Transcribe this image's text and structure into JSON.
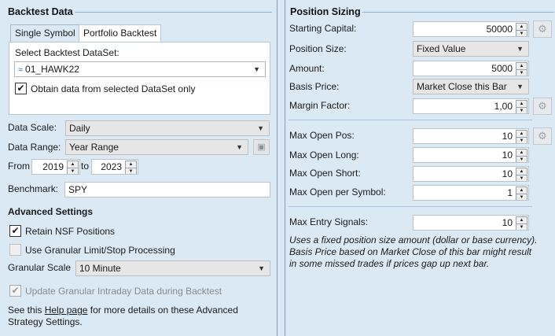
{
  "backtest": {
    "title": "Backtest Data",
    "tabs": [
      {
        "label": "Single Symbol",
        "active": false
      },
      {
        "label": "Portfolio Backtest",
        "active": true
      }
    ],
    "select_dataset_label": "Select Backtest DataSet:",
    "dataset_value": "01_HAWK22",
    "obtain_label": "Obtain data from selected DataSet only",
    "obtain_checked": true,
    "data_scale_label": "Data Scale:",
    "data_scale_value": "Daily",
    "data_range_label": "Data Range:",
    "data_range_value": "Year Range",
    "from_label": "From",
    "from_value": "2019",
    "to_label": "to",
    "to_value": "2023",
    "benchmark_label": "Benchmark:",
    "benchmark_value": "SPY"
  },
  "advanced": {
    "title": "Advanced Settings",
    "retain_label": "Retain NSF Positions",
    "retain_checked": true,
    "granular_label": "Use Granular Limit/Stop Processing",
    "granular_checked": false,
    "granular_scale_label": "Granular Scale",
    "granular_scale_value": "10 Minute",
    "update_label": "Update Granular Intraday Data during Backtest",
    "update_checked": true,
    "help_prefix": "See this ",
    "help_link": "Help page",
    "help_suffix": " for more details on these Advanced",
    "help_line2": "Strategy Settings."
  },
  "sizing": {
    "title": "Position Sizing",
    "starting_capital_label": "Starting Capital:",
    "starting_capital_value": "50000",
    "position_size_label": "Position Size:",
    "position_size_value": "Fixed Value",
    "amount_label": "Amount:",
    "amount_value": "5000",
    "basis_price_label": "Basis Price:",
    "basis_price_value": "Market Close this Bar",
    "margin_factor_label": "Margin Factor:",
    "margin_factor_value": "1,00",
    "max_open_pos_label": "Max Open Pos:",
    "max_open_pos_value": "10",
    "max_open_long_label": "Max Open Long:",
    "max_open_long_value": "10",
    "max_open_short_label": "Max Open Short:",
    "max_open_short_value": "10",
    "max_open_symbol_label": "Max Open per Symbol:",
    "max_open_symbol_value": "1",
    "max_entry_label": "Max Entry Signals:",
    "max_entry_value": "10",
    "description_line1": "Uses a fixed position size amount (dollar or base currency).",
    "description_line2": "Basis Price based on Market Close of this bar might result",
    "description_line3": "in some missed trades if prices gap up next bar."
  },
  "icons": {
    "gear": "gear-icon",
    "save": "save-icon",
    "dataset": "dataset-icon",
    "chevron": "chevron-down-icon",
    "check": "checkmark-icon"
  }
}
